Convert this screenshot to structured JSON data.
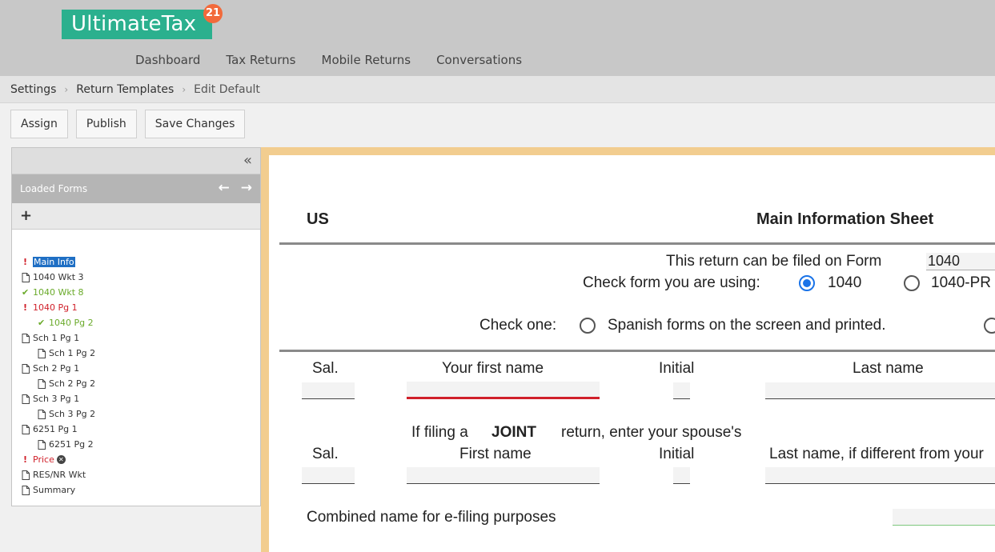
{
  "app": {
    "logo_text": "UltimateTax",
    "logo_badge": "21"
  },
  "nav": {
    "items": [
      {
        "label": "Dashboard"
      },
      {
        "label": "Tax Returns"
      },
      {
        "label": "Mobile Returns"
      },
      {
        "label": "Conversations"
      }
    ]
  },
  "breadcrumb": {
    "items": [
      {
        "label": "Settings"
      },
      {
        "label": "Return Templates"
      },
      {
        "label": "Edit Default"
      }
    ]
  },
  "toolbar": {
    "assign_label": "Assign",
    "publish_label": "Publish",
    "save_label": "Save Changes"
  },
  "sidebar": {
    "collapse_icon": "double-chevron-left-icon",
    "loaded_forms_label": "Loaded Forms",
    "add_label": "+",
    "tree": [
      {
        "label": "Main Info",
        "status": "warning",
        "selected": true
      },
      {
        "label": "1040 Wkt 3",
        "status": "document"
      },
      {
        "label": "1040 Wkt 8",
        "status": "complete"
      },
      {
        "label": "1040 Pg 1",
        "status": "warning"
      },
      {
        "label": "1040 Pg 2",
        "status": "complete"
      },
      {
        "label": "Sch 1 Pg 1",
        "status": "document"
      },
      {
        "label": "Sch 1 Pg 2",
        "status": "document"
      },
      {
        "label": "Sch 2 Pg 1",
        "status": "document"
      },
      {
        "label": "Sch 2 Pg 2",
        "status": "document"
      },
      {
        "label": "Sch 3 Pg 1",
        "status": "document"
      },
      {
        "label": "Sch 3 Pg 2",
        "status": "document"
      },
      {
        "label": "6251 Pg 1",
        "status": "document"
      },
      {
        "label": "6251 Pg 2",
        "status": "document"
      },
      {
        "label": "Price",
        "status": "warning"
      },
      {
        "label": "RES/NR Wkt",
        "status": "document"
      },
      {
        "label": "Summary",
        "status": "document"
      }
    ]
  },
  "form": {
    "country": "US",
    "title": "Main Information Sheet",
    "filed_on_label": "This return can be filed on Form",
    "filed_on_value": "1040",
    "check_form_label": "Check form you are using:",
    "option_1040": "1040",
    "option_1040pr": "1040-PR",
    "check_one_label": "Check one:",
    "spanish_option": "Spanish forms on the screen and printed.",
    "sal_label": "Sal.",
    "first_name_label": "Your first name",
    "initial_label": "Initial",
    "last_name_label": "Last name",
    "if_filing_label": "If filing a",
    "joint_label": "JOINT",
    "return_spouse_label": "return, enter your spouse's",
    "spouse_sal_label": "Sal.",
    "spouse_first_label": "First name",
    "spouse_initial_label": "Initial",
    "spouse_last_label": "Last name, if different from your",
    "combined_label": "Combined name for e-filing purposes"
  },
  "colors": {
    "header_bg": "#c8c8c8",
    "logo_bg": "#2bb08e",
    "badge": "#f26a3b",
    "frame": "#f2cd8f",
    "warning": "#d0202a",
    "complete": "#6aaa2a",
    "selected": "#1f6fc4",
    "radio_on": "#1a73e8"
  }
}
